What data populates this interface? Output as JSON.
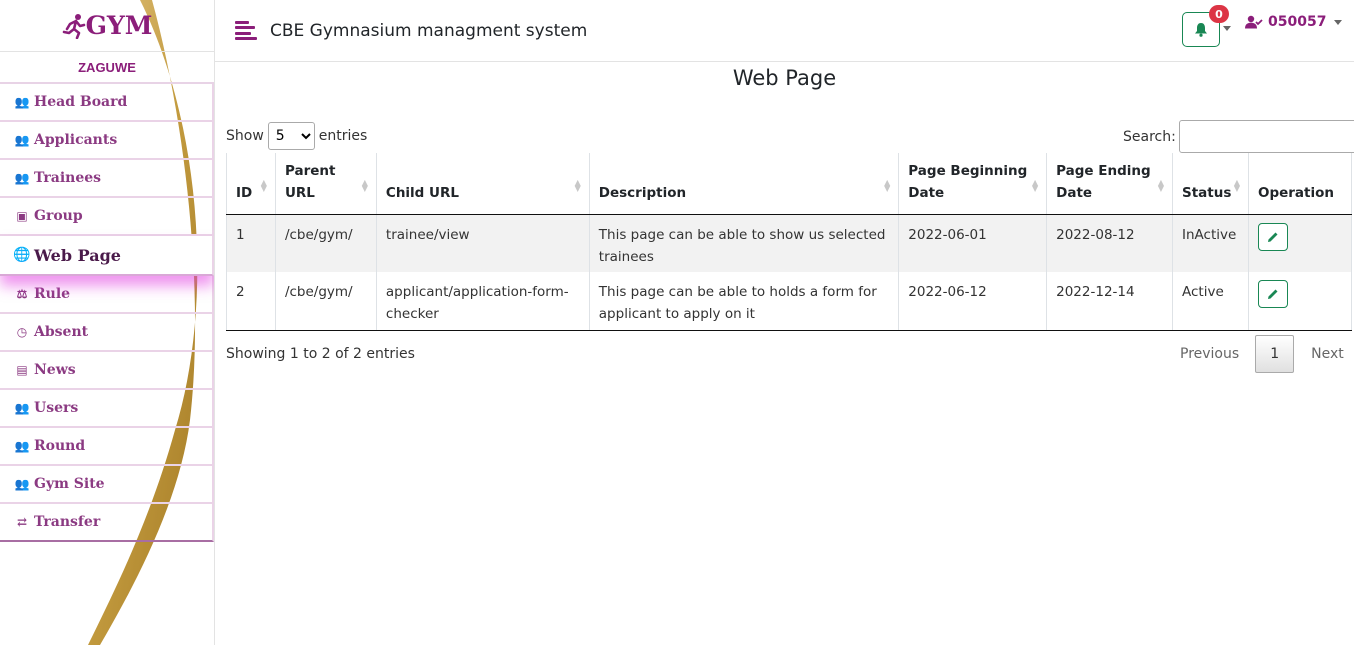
{
  "brand": {
    "logo_text": "GYM"
  },
  "sidebar": {
    "user_label": "ZAGUWE",
    "items": [
      {
        "label": "Head Board",
        "icon": "users-icon"
      },
      {
        "label": "Applicants",
        "icon": "users-icon"
      },
      {
        "label": "Trainees",
        "icon": "users-icon"
      },
      {
        "label": "Group",
        "icon": "group-icon"
      },
      {
        "label": "Web Page",
        "icon": "globe-icon",
        "active": true
      },
      {
        "label": "Rule",
        "icon": "scale-icon"
      },
      {
        "label": "Absent",
        "icon": "clock-icon"
      },
      {
        "label": "News",
        "icon": "newspaper-icon"
      },
      {
        "label": "Users",
        "icon": "users-icon"
      },
      {
        "label": "Round",
        "icon": "users-icon"
      },
      {
        "label": "Gym Site",
        "icon": "users-icon"
      },
      {
        "label": "Transfer",
        "icon": "transfer-icon"
      }
    ]
  },
  "header": {
    "title": "CBE Gymnasium managment system",
    "notifications_count": "0",
    "username": "050057"
  },
  "main": {
    "page_title": "Web Page",
    "show_label": "Show",
    "entries_value": "5",
    "entries_label": "entries",
    "search_label": "Search:",
    "search_value": "",
    "table": {
      "columns": [
        "ID",
        "Parent URL",
        "Child URL",
        "Description",
        "Page Beginning Date",
        "Page Ending Date",
        "Status",
        "Operation"
      ],
      "rows": [
        {
          "id": "1",
          "parent_url": "/cbe/gym/",
          "child_url": "trainee/view",
          "description": "This page can be able to show us selected trainees",
          "begin_date": "2022-06-01",
          "end_date": "2022-08-12",
          "status": "InActive"
        },
        {
          "id": "2",
          "parent_url": "/cbe/gym/",
          "child_url": "applicant/application-form-checker",
          "description": "This page can be able to holds a form for applicant to apply on it",
          "begin_date": "2022-06-12",
          "end_date": "2022-12-14",
          "status": "Active"
        }
      ]
    },
    "info_text": "Showing 1 to 2 of 2 entries",
    "pagination": {
      "previous": "Previous",
      "current": "1",
      "next": "Next"
    }
  },
  "colors": {
    "brand": "#8b1e7a",
    "success": "#198754",
    "danger": "#dc3545",
    "swoosh": "#c29a3e"
  }
}
